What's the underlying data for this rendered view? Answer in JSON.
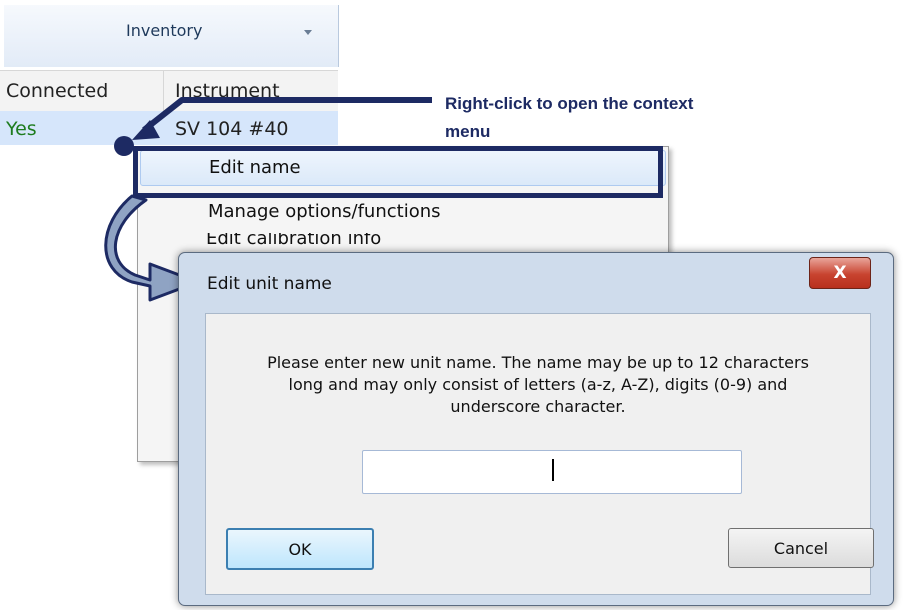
{
  "tab": {
    "label": "Inventory"
  },
  "grid": {
    "headers": [
      "Connected",
      "Instrument"
    ],
    "row": {
      "connected": "Yes",
      "instrument": "SV 104 #40"
    }
  },
  "menu": {
    "items": [
      {
        "label": "Edit name"
      },
      {
        "label": "Manage options/functions"
      },
      {
        "label": "Edit calibration info"
      }
    ]
  },
  "annotation": {
    "line1": "Right-click to open the context",
    "line2": "menu"
  },
  "dialog": {
    "title": "Edit unit name",
    "close_label": "X",
    "message_lines": [
      "Please enter new unit name. The name may be up to 12 characters",
      "long and may only consist of letters (a-z, A-Z), digits (0-9) and",
      "underscore character."
    ],
    "input_value": "",
    "ok_label": "OK",
    "cancel_label": "Cancel"
  },
  "colors": {
    "annotation": "#1d2a63",
    "connected_yes": "#1e7c1e",
    "close_button": "#c8432f"
  }
}
